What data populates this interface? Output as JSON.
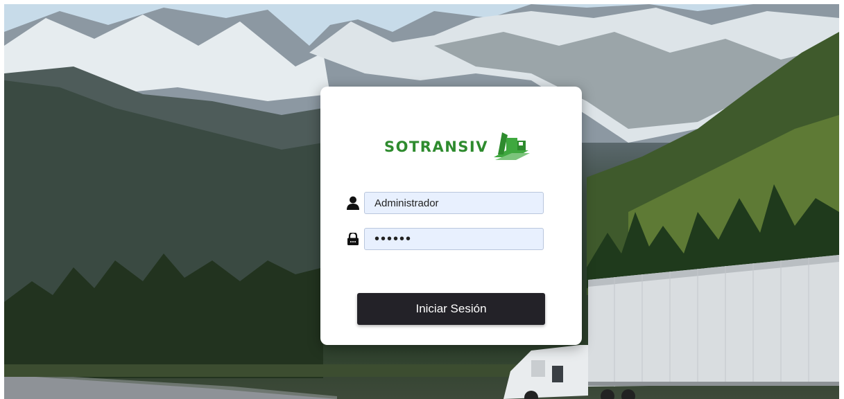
{
  "brand": {
    "name": "SOTRANSIV",
    "logo_color": "#2e8b2e"
  },
  "login_form": {
    "username_value": "Administrador",
    "password_value": "••••••",
    "submit_label": "Iniciar Sesión"
  },
  "icons": {
    "username": "user-icon",
    "password": "lock-icon"
  },
  "colors": {
    "button_bg": "#232228",
    "input_bg": "#e8f0fe",
    "card_bg": "#ffffff"
  }
}
